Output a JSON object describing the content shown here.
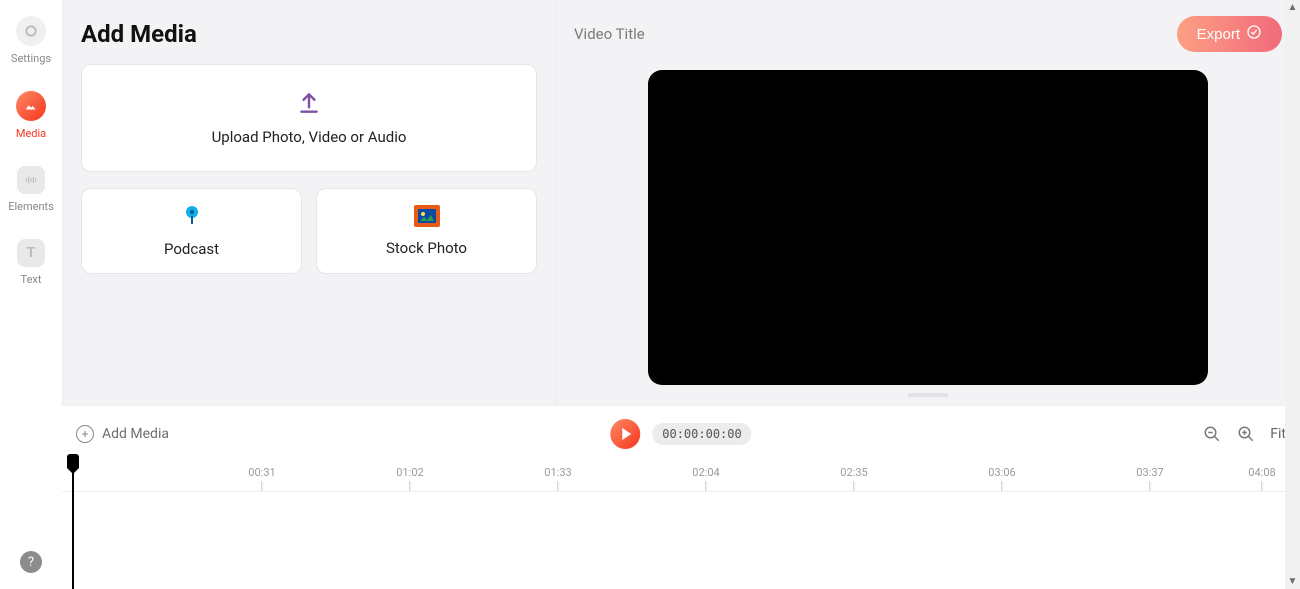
{
  "sidebar": {
    "items": [
      {
        "key": "settings",
        "label": "Settings"
      },
      {
        "key": "media",
        "label": "Media"
      },
      {
        "key": "elements",
        "label": "Elements"
      },
      {
        "key": "text",
        "label": "Text"
      }
    ],
    "help_glyph": "?"
  },
  "panel": {
    "title": "Add Media",
    "upload_label": "Upload Photo, Video or Audio",
    "podcast_label": "Podcast",
    "stock_label": "Stock Photo"
  },
  "preview": {
    "title_placeholder": "Video Title",
    "export_label": "Export"
  },
  "timeline": {
    "add_media_label": "Add Media",
    "timecode": "00:00:00:00",
    "fit_label": "Fit",
    "ticks": [
      "00:31",
      "01:02",
      "01:33",
      "02:04",
      "02:35",
      "03:06",
      "03:37",
      "04:08"
    ]
  }
}
